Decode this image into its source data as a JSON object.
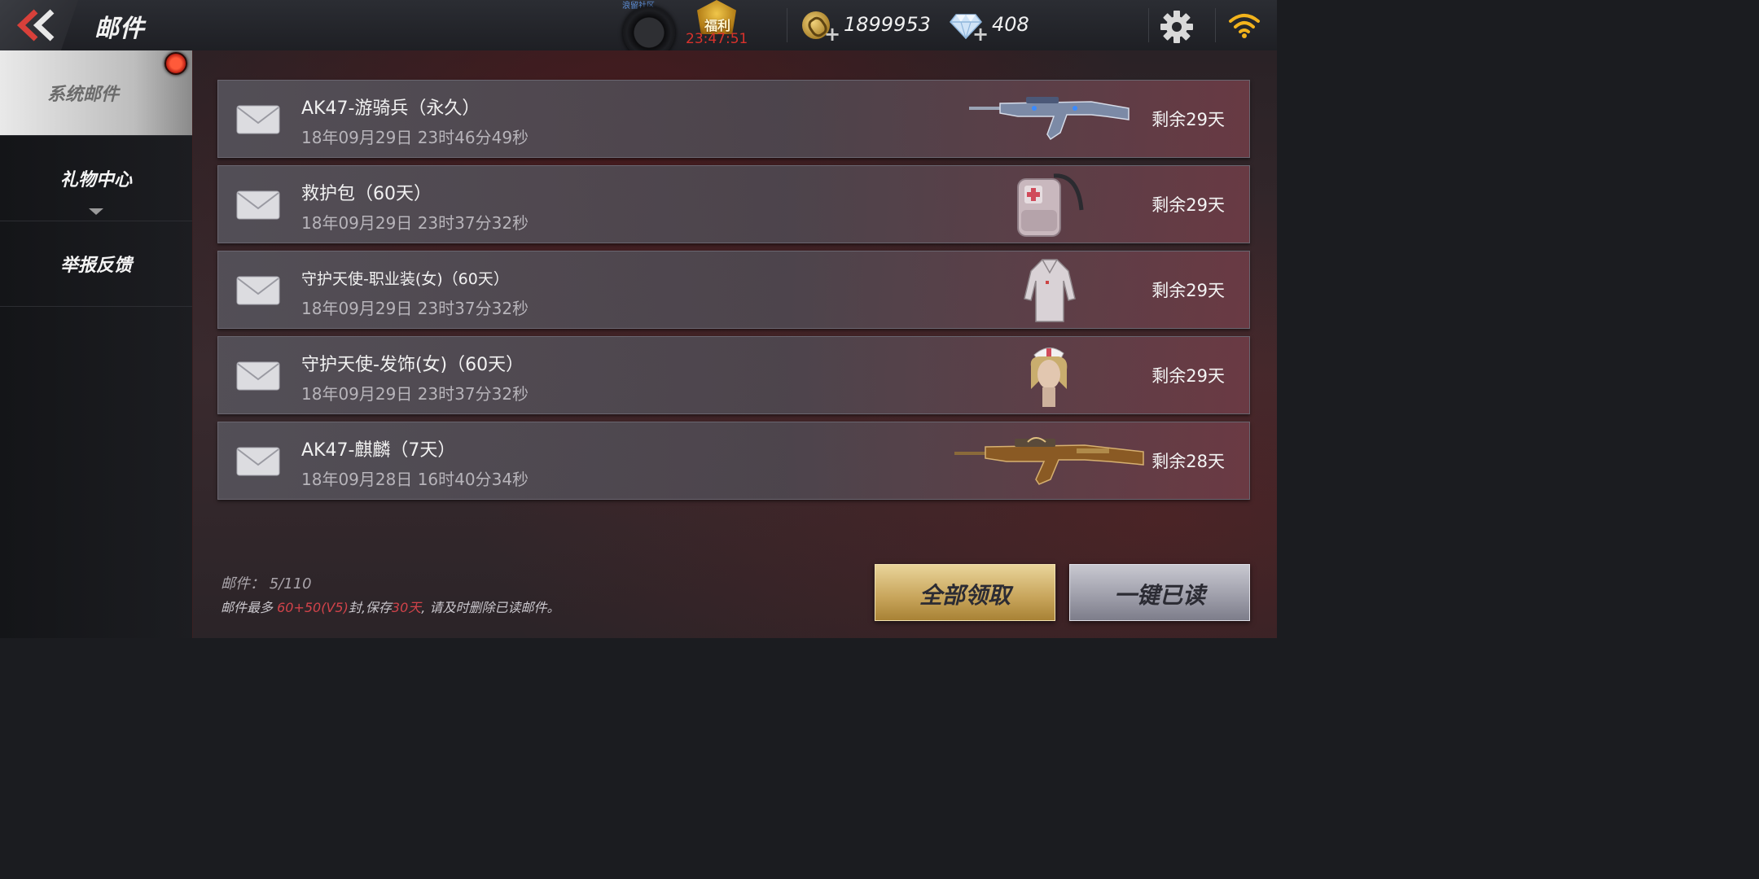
{
  "header": {
    "title": "邮件",
    "community_label": "浪留社区",
    "welfare_label": "福利",
    "welfare_timer": "23:47:51",
    "gold_amount": "1899953",
    "diamond_amount": "408"
  },
  "sidebar": {
    "items": [
      {
        "label": "系统邮件",
        "active": true
      },
      {
        "label": "礼物中心",
        "active": false
      },
      {
        "label": "举报反馈",
        "active": false
      }
    ]
  },
  "mails": [
    {
      "title": "AK47-游骑兵（永久）",
      "date": "18年09月29日 23时46分49秒",
      "remaining": "剩余29天",
      "item_icon": "ak47-ranger-rifle"
    },
    {
      "title": "救护包（60天）",
      "date": "18年09月29日 23时37分32秒",
      "remaining": "剩余29天",
      "item_icon": "medic-backpack"
    },
    {
      "title": "守护天使-职业装(女)（60天）",
      "date": "18年09月29日 23时37分32秒",
      "remaining": "剩余29天",
      "item_icon": "nurse-uniform"
    },
    {
      "title": "守护天使-发饰(女)（60天）",
      "date": "18年09月29日 23时37分32秒",
      "remaining": "剩余29天",
      "item_icon": "nurse-hair-head"
    },
    {
      "title": "AK47-麒麟（7天）",
      "date": "18年09月28日 16时40分34秒",
      "remaining": "剩余28天",
      "item_icon": "ak47-kirin-rifle"
    }
  ],
  "footer": {
    "count_label": "邮件：",
    "count_value": "5/110",
    "note_prefix": "邮件最多 ",
    "note_limit": "60+50(V5)",
    "note_mid": "封,保存",
    "note_days": "30天",
    "note_suffix": ", 请及时删除已读邮件。"
  },
  "buttons": {
    "claim_all": "全部领取",
    "mark_all_read": "一键已读"
  },
  "colors": {
    "accent_red": "#d1434a",
    "timer_red": "#d8322c",
    "claim_gold": "#c7a45a",
    "read_silver": "#9c9ca8"
  }
}
